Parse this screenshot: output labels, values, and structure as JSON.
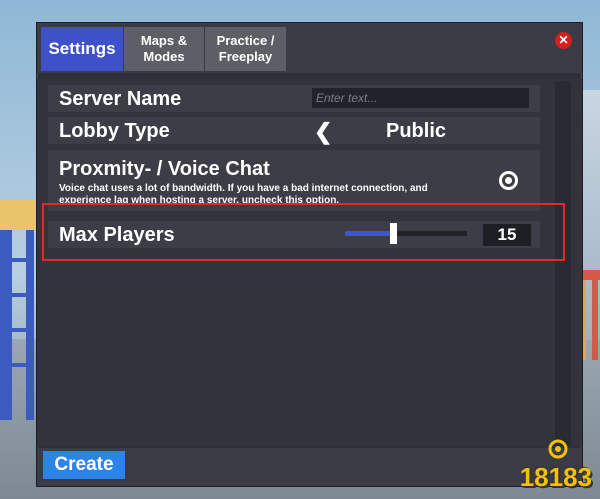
{
  "tabs": [
    {
      "label": "Settings",
      "active": true
    },
    {
      "label": "Maps &\nModes",
      "active": false
    },
    {
      "label": "Practice /\nFreeplay",
      "active": false
    }
  ],
  "close_icon": "close-icon",
  "server_name": {
    "label": "Server Name",
    "placeholder": "Enter text...",
    "value": ""
  },
  "lobby_type": {
    "label": "Lobby Type",
    "value": "Public",
    "prev_icon": "chevron-left-icon"
  },
  "voice_chat": {
    "label": "Proxmity- / Voice Chat",
    "description": "Voice chat uses a lot of bandwidth. If you have a bad internet connection, and experience lag when hosting a server, uncheck this option.",
    "enabled": true
  },
  "max_players": {
    "label": "Max Players",
    "value": "15",
    "slider_fraction": 0.37
  },
  "footer": {
    "create_label": "Create"
  },
  "watermark": {
    "text": "18183"
  },
  "colors": {
    "accent": "#3f51c8",
    "tab_inactive": "#5d5e66",
    "panel": "#32333b",
    "row": "#3c3d46",
    "create": "#2b84e6",
    "close": "#d41f1f",
    "highlight": "#e02a2a",
    "slider_fill": "#4152d8"
  }
}
